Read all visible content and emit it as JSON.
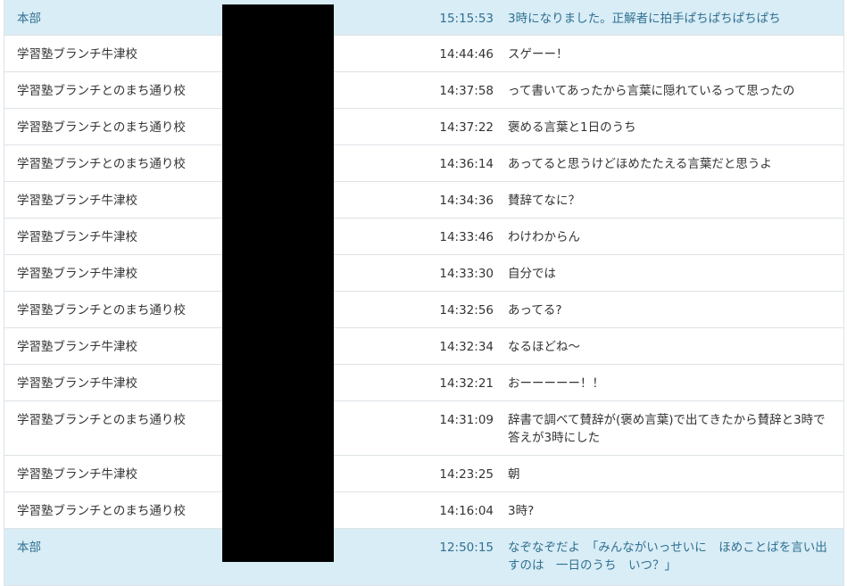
{
  "messages": [
    {
      "sender": "本部",
      "time": "15:15:53",
      "text": "3時になりました。正解者に拍手ぱちぱちぱちぱち",
      "hq": true
    },
    {
      "sender": "学習塾ブランチ牛津校",
      "time": "14:44:46",
      "text": "スゲーー！",
      "hq": false
    },
    {
      "sender": "学習塾ブランチとのまち通り校",
      "time": "14:37:58",
      "text": "って書いてあったから言葉に隠れているって思ったの",
      "hq": false
    },
    {
      "sender": "学習塾ブランチとのまち通り校",
      "time": "14:37:22",
      "text": "褒める言葉と1日のうち",
      "hq": false
    },
    {
      "sender": "学習塾ブランチとのまち通り校",
      "time": "14:36:14",
      "text": "あってると思うけどほめたたえる言葉だと思うよ",
      "hq": false
    },
    {
      "sender": "学習塾ブランチ牛津校",
      "time": "14:34:36",
      "text": "賛辞てなに？",
      "hq": false
    },
    {
      "sender": "学習塾ブランチ牛津校",
      "time": "14:33:46",
      "text": "わけわからん",
      "hq": false
    },
    {
      "sender": "学習塾ブランチ牛津校",
      "time": "14:33:30",
      "text": "自分では",
      "hq": false
    },
    {
      "sender": "学習塾ブランチとのまち通り校",
      "time": "14:32:56",
      "text": "あってる?",
      "hq": false
    },
    {
      "sender": "学習塾ブランチ牛津校",
      "time": "14:32:34",
      "text": "なるほどね～",
      "hq": false
    },
    {
      "sender": "学習塾ブランチ牛津校",
      "time": "14:32:21",
      "text": "おーーーーー！！",
      "hq": false
    },
    {
      "sender": "学習塾ブランチとのまち通り校",
      "time": "14:31:09",
      "text": "辞書で調べて賛辞が(褒め言葉)で出てきたから賛辞と3時で答えが3時にした",
      "hq": false
    },
    {
      "sender": "学習塾ブランチ牛津校",
      "time": "14:23:25",
      "text": "朝",
      "hq": false
    },
    {
      "sender": "学習塾ブランチとのまち通り校",
      "time": "14:16:04",
      "text": "3時?",
      "hq": false
    },
    {
      "sender": "本部",
      "time": "12:50:15",
      "text": "なぞなぞだよ　「みんながいっせいに　ほめことばを言い出すのは　一日のうち　いつ？」",
      "hq": true
    }
  ]
}
